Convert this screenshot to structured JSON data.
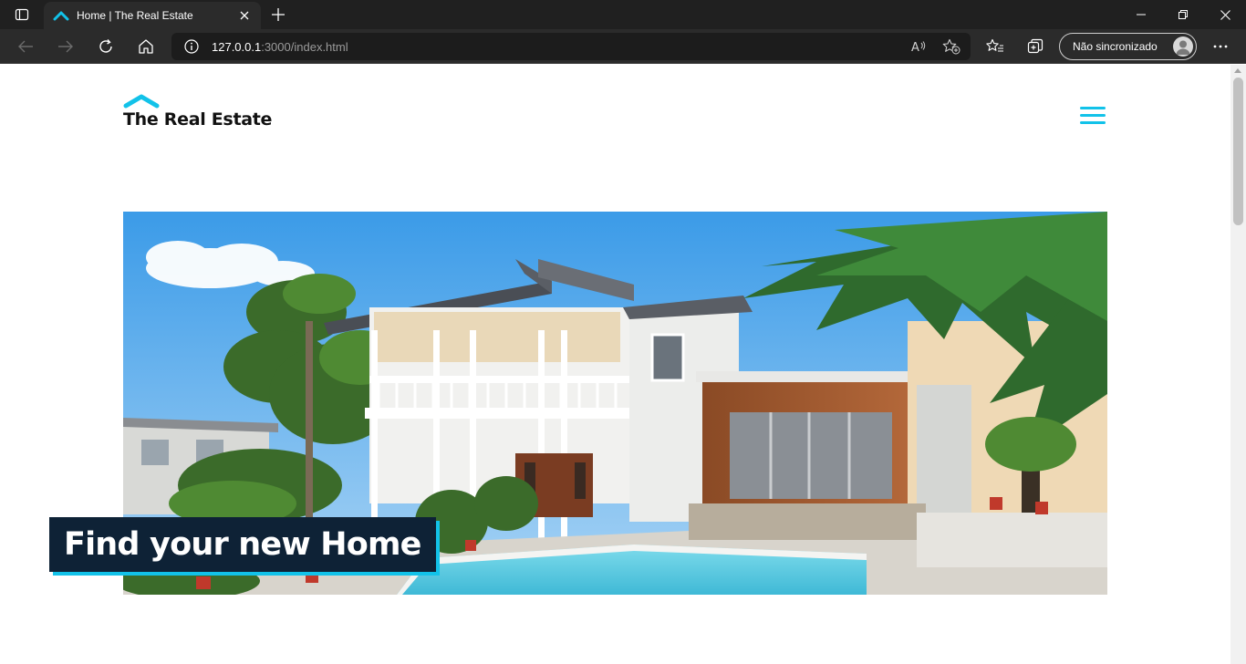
{
  "browser": {
    "tab": {
      "title": "Home | The Real Estate"
    },
    "address": {
      "host": "127.0.0.1",
      "path": ":3000/index.html"
    },
    "profile": {
      "label": "Não sincronizado"
    }
  },
  "page": {
    "brand": "The Real Estate",
    "hero": {
      "headline": "Find your new Home"
    }
  },
  "colors": {
    "accent": "#12c2e9",
    "headline_bg": "#0e2236",
    "chrome_dark": "#202020",
    "chrome_toolbar": "#2b2b2b"
  },
  "icons": {
    "tab_actions": "tab-actions-icon",
    "favicon": "roof-icon",
    "close": "close-icon",
    "new_tab": "plus-icon",
    "back": "arrow-left-icon",
    "forward": "arrow-right-icon",
    "refresh": "refresh-icon",
    "home": "home-icon",
    "info": "info-icon",
    "read_aloud": "read-aloud-icon",
    "add_favorite": "star-add-icon",
    "favorites": "favorites-icon",
    "collections": "collections-icon",
    "menu": "more-icon",
    "hamburger": "hamburger-icon"
  }
}
